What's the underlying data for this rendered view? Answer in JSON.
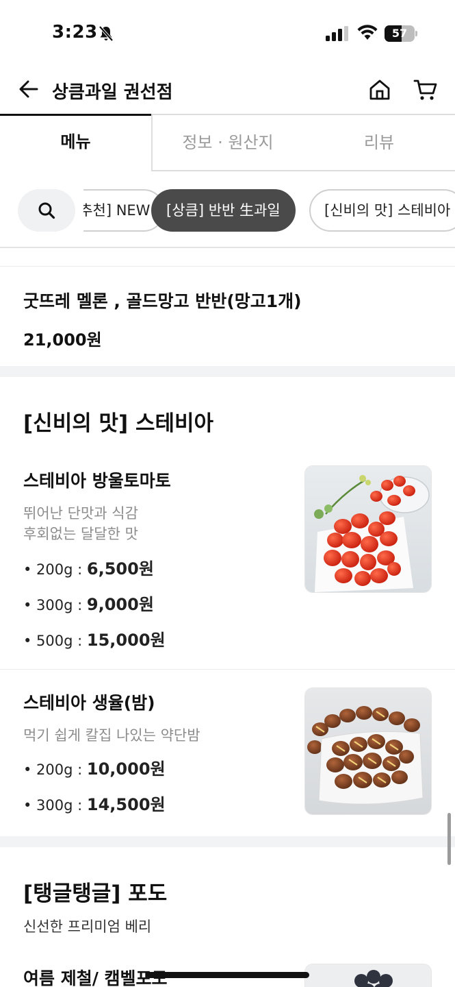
{
  "status": {
    "time": "3:23",
    "battery": "57",
    "battery_level": 0.57
  },
  "header": {
    "title": "상큼과일 권선점"
  },
  "tabs": [
    {
      "label": "메뉴",
      "active": true
    },
    {
      "label": "정보 · 원산지",
      "active": false
    },
    {
      "label": "리뷰",
      "active": false
    }
  ],
  "chips": [
    {
      "label": "[추천] NEW",
      "active": false
    },
    {
      "label": "[상큼] 반반 生과일",
      "active": true
    },
    {
      "label": "[신비의 맛] 스테비아",
      "active": false
    }
  ],
  "items": [
    {
      "name": "굿뜨레 멜론 , 골드망고  반반(망고1개)",
      "price": "21,000원"
    }
  ],
  "sections": [
    {
      "title": "[신비의 맛] 스테비아",
      "items": [
        {
          "name": "스테비아 방울토마토",
          "desc": [
            "뛰어난 단맛과 식감",
            "후회없는 달달한 맛"
          ],
          "options": [
            {
              "size": "• 200g : ",
              "price": "6,500원"
            },
            {
              "size": "• 300g : ",
              "price": "9,000원"
            },
            {
              "size": "• 500g : ",
              "price": "15,000원"
            }
          ]
        },
        {
          "name": "스테비아 생율(밤)",
          "desc": [
            "먹기 쉽게 칼집 나있는 약단밤"
          ],
          "options": [
            {
              "size": "• 200g : ",
              "price": "10,000원"
            },
            {
              "size": "• 300g : ",
              "price": "14,500원"
            }
          ]
        }
      ]
    },
    {
      "title": "[탱글탱글] 포도",
      "subtitle": "신선한 프리미엄  베리",
      "items": [
        {
          "name": "여름 제철/ 캠벨포도"
        }
      ]
    }
  ],
  "colors": {
    "active_chip": "#4a4a4a",
    "muted_text": "#8c8c8c",
    "divider": "#ececec"
  }
}
